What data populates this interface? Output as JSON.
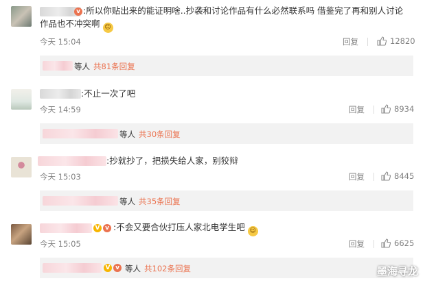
{
  "comments": [
    {
      "text": ":所以你贴出来的能证明啥..抄袭和讨论作品有什么必然联系吗 借鉴完了再和别人讨论",
      "text2": "作品也不冲突啊",
      "time": "今天 15:04",
      "reply_label": "回复",
      "likes": "12820",
      "replies_who": "等人",
      "replies_more": "共81条回复"
    },
    {
      "text": ":不止一次了吧",
      "time": "今天 14:59",
      "reply_label": "回复",
      "likes": "8934",
      "replies_who": "等人",
      "replies_more": "共30条回复"
    },
    {
      "text": ":抄就抄了，把损失给人家，别狡辩",
      "time": "今天 15:03",
      "reply_label": "回复",
      "likes": "8445",
      "replies_who": "等人",
      "replies_more": "共35条回复"
    },
    {
      "text": ":不会又要合伙打压人家北电学生吧",
      "time": "今天 15:05",
      "reply_label": "回复",
      "likes": "6625",
      "replies_who": "等人",
      "replies_more": "共102条回复"
    }
  ],
  "watermark": "墨海寻龙",
  "colors": {
    "link": "#eb7350",
    "muted": "#808080",
    "reply_bg": "#f2f2f2"
  },
  "icons": {
    "like": "thumbs-up-icon",
    "emoji": "smiley-emoji-icon",
    "verified": "v-badge-icon"
  }
}
